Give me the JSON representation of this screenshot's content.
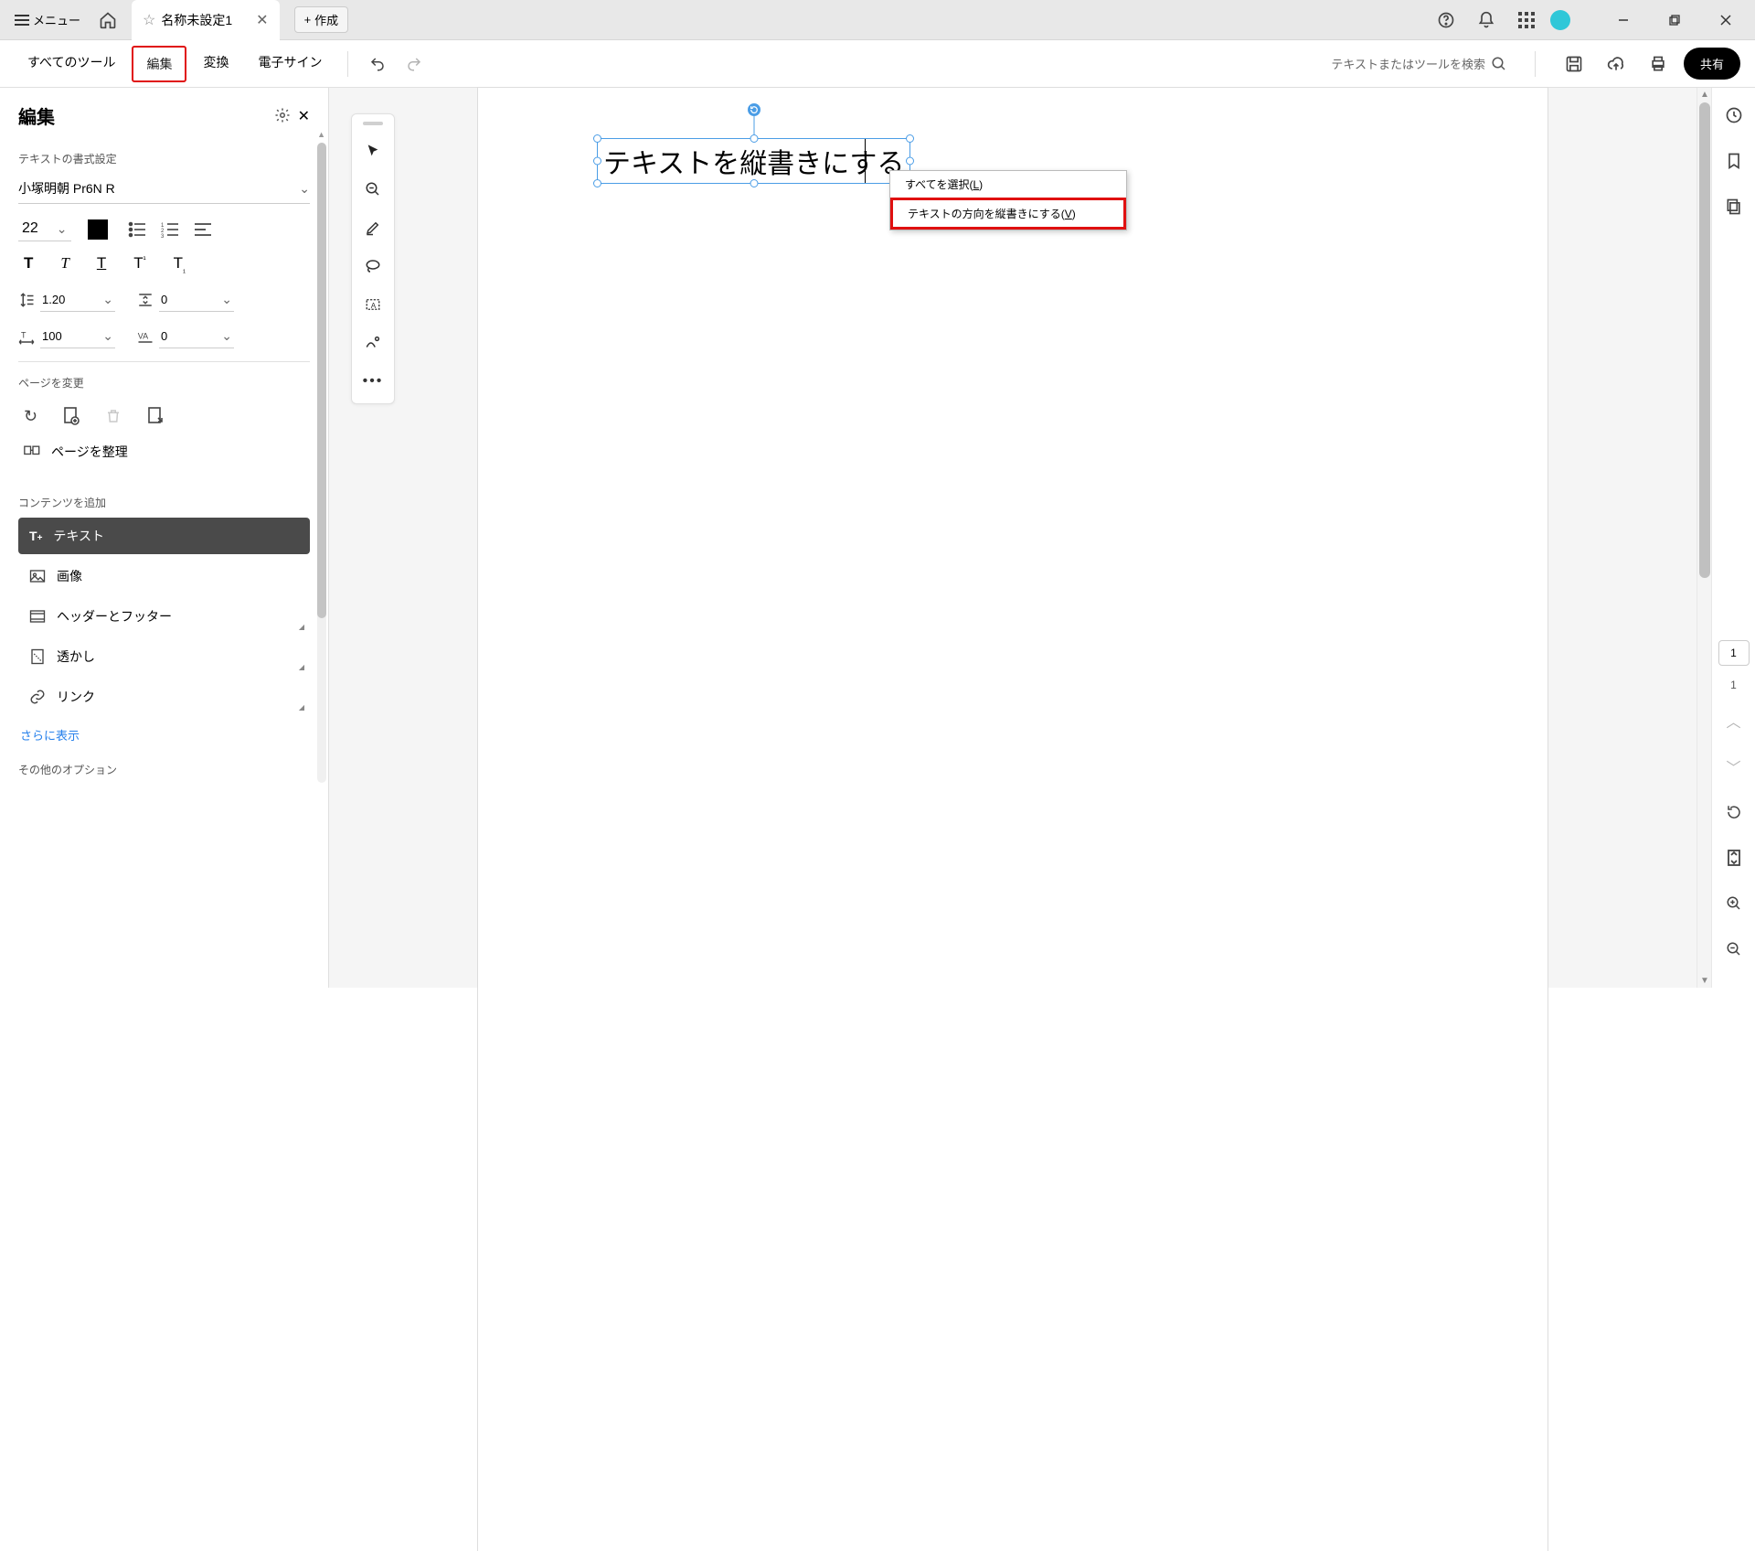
{
  "titlebar": {
    "menu": "メニュー",
    "tab_title": "名称未設定1",
    "create": "作成"
  },
  "toolbar": {
    "tabs": {
      "all": "すべてのツール",
      "edit": "編集",
      "convert": "変換",
      "esign": "電子サイン"
    },
    "search_placeholder": "テキストまたはツールを検索",
    "share": "共有"
  },
  "panel": {
    "title": "編集",
    "section_textfmt": "テキストの書式設定",
    "font": "小塚明朝 Pr6N R",
    "size": "22",
    "line": "1.20",
    "para": "0",
    "hscale": "100",
    "kern": "0",
    "section_page": "ページを変更",
    "organize": "ページを整理",
    "section_content": "コンテンツを追加",
    "items": {
      "text": "テキスト",
      "image": "画像",
      "hf": "ヘッダーとフッター",
      "wm": "透かし",
      "link": "リンク"
    },
    "show_more": "さらに表示",
    "section_other": "その他のオプション"
  },
  "doc": {
    "text": "テキストを縦書きにする"
  },
  "ctx": {
    "select_all_pre": "すべてを選択(",
    "select_all_key": "L",
    "select_all_post": ")",
    "vertical_pre": "テキストの方向を縦書きにする(",
    "vertical_key": "V",
    "vertical_post": ")"
  },
  "nav": {
    "page_input": "1",
    "page_total": "1"
  }
}
